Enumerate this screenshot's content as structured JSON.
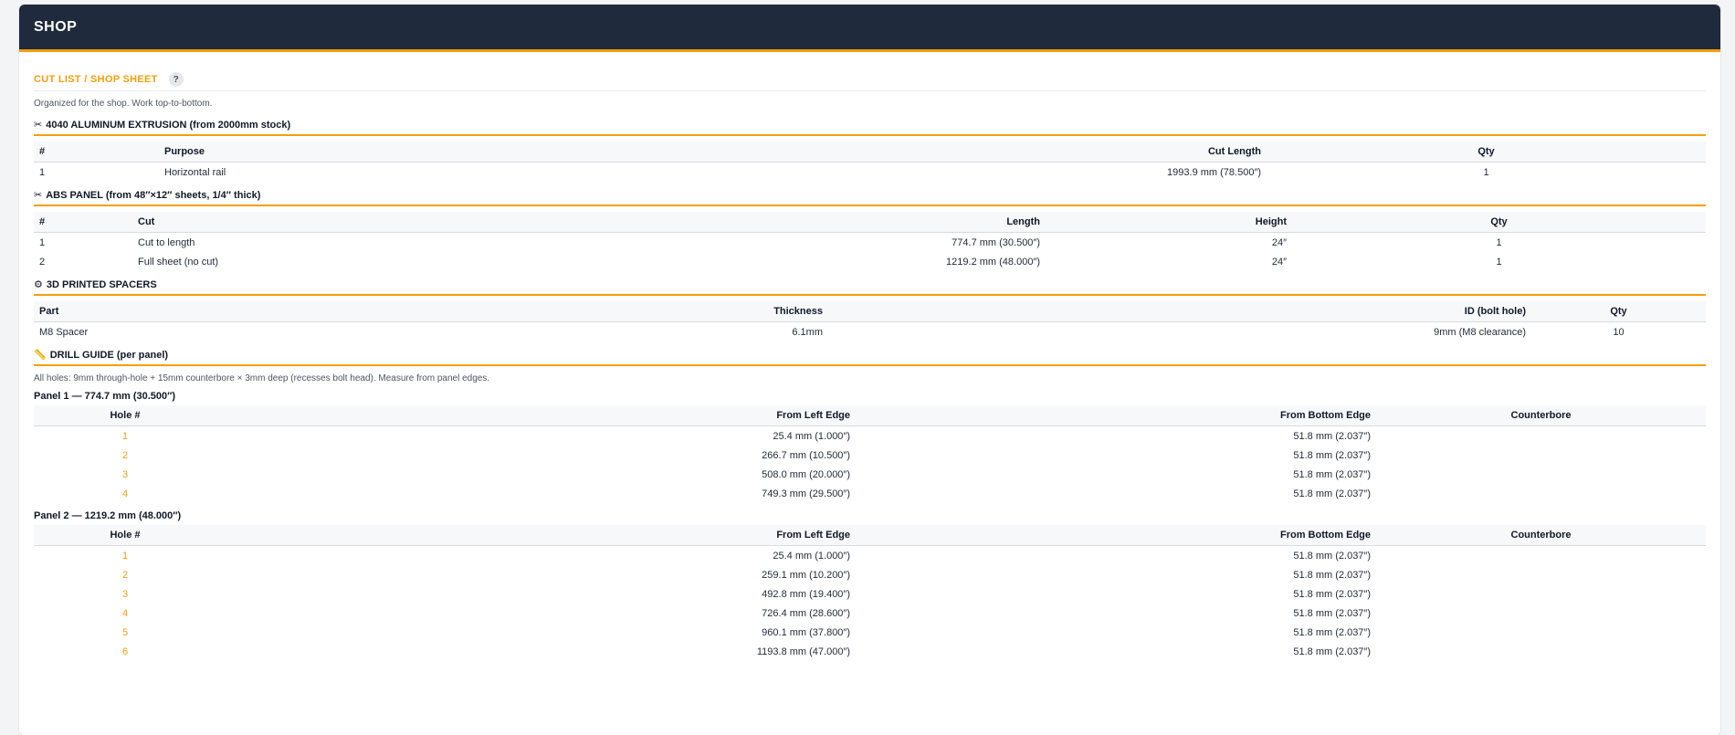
{
  "app": {
    "title": "SHOP"
  },
  "section": {
    "label": "CUT LIST / SHOP SHEET",
    "help": "?"
  },
  "intro": "Organized for the shop. Work top-to-bottom.",
  "extrusion": {
    "title": "4040 ALUMINUM EXTRUSION (from 2000mm stock)",
    "icon": "scissors-icon",
    "headers": [
      "#",
      "Purpose",
      "Cut Length",
      "Qty"
    ],
    "rows": [
      [
        "1",
        "Horizontal rail",
        "1993.9 mm (78.500″)",
        "1"
      ]
    ]
  },
  "abs": {
    "title": "ABS PANEL (from 48″×12″ sheets, 1/4″ thick)",
    "icon": "scissors-icon",
    "headers": [
      "#",
      "Cut",
      "Length",
      "Height",
      "Qty"
    ],
    "rows": [
      [
        "1",
        "Cut to length",
        "774.7 mm (30.500″)",
        "24″",
        "1"
      ],
      [
        "2",
        "Full sheet (no cut)",
        "1219.2 mm (48.000″)",
        "24″",
        "1"
      ]
    ]
  },
  "spacers": {
    "title": "3D PRINTED SPACERS",
    "icon": "gear-icon",
    "headers": [
      "Part",
      "Thickness",
      "ID (bolt hole)",
      "Qty"
    ],
    "rows": [
      [
        "M8 Spacer",
        "6.1mm",
        "9mm (M8 clearance)",
        "10"
      ]
    ]
  },
  "drill": {
    "title": "DRILL GUIDE (per panel)",
    "icon": "ruler-icon",
    "note": "All holes: 9mm through-hole + 15mm counterbore × 3mm deep (recesses bolt head). Measure from panel edges.",
    "headers": [
      "Hole #",
      "From Left Edge",
      "From Bottom Edge",
      "Counterbore"
    ],
    "panels": [
      {
        "title": "Panel 1 — 774.7 mm (30.500″)",
        "rows": [
          [
            "1",
            "25.4 mm (1.000″)",
            "51.8 mm (2.037″)",
            ""
          ],
          [
            "2",
            "266.7 mm (10.500″)",
            "51.8 mm (2.037″)",
            ""
          ],
          [
            "3",
            "508.0 mm (20.000″)",
            "51.8 mm (2.037″)",
            ""
          ],
          [
            "4",
            "749.3 mm (29.500″)",
            "51.8 mm (2.037″)",
            ""
          ]
        ]
      },
      {
        "title": "Panel 2 — 1219.2 mm (48.000″)",
        "rows": [
          [
            "1",
            "25.4 mm (1.000″)",
            "51.8 mm (2.037″)",
            ""
          ],
          [
            "2",
            "259.1 mm (10.200″)",
            "51.8 mm (2.037″)",
            ""
          ],
          [
            "3",
            "492.8 mm (19.400″)",
            "51.8 mm (2.037″)",
            ""
          ],
          [
            "4",
            "726.4 mm (28.600″)",
            "51.8 mm (2.037″)",
            ""
          ],
          [
            "5",
            "960.1 mm (37.800″)",
            "51.8 mm (2.037″)",
            ""
          ],
          [
            "6",
            "1193.8 mm (47.000″)",
            "51.8 mm (2.037″)",
            ""
          ]
        ]
      }
    ]
  },
  "colors": {
    "accent": "#f59e0b",
    "header_bg": "#1f2a3c"
  }
}
